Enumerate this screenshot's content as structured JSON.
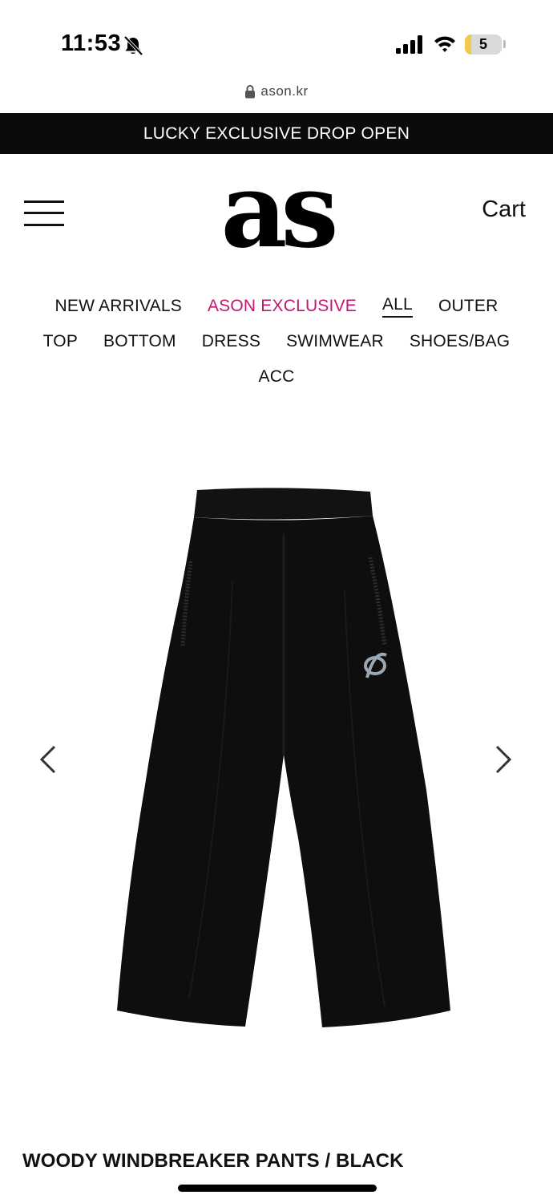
{
  "status_bar": {
    "time": "11:53",
    "battery_level": "5",
    "icons": [
      "bell-slash-icon",
      "signal-icon",
      "wifi-icon",
      "battery-icon"
    ]
  },
  "browser": {
    "url": "ason.kr"
  },
  "announcement": {
    "text": "LUCKY EXCLUSIVE DROP OPEN"
  },
  "header": {
    "logo_text": "as",
    "cart_label": "Cart"
  },
  "categories": {
    "row1": [
      "NEW ARRIVALS",
      "ASON EXCLUSIVE",
      "ALL",
      "OUTER"
    ],
    "row2": [
      "TOP",
      "BOTTOM",
      "DRESS",
      "SWIMWEAR",
      "SHOES/BAG"
    ],
    "row3": [
      "ACC"
    ],
    "active": "ALL",
    "accent_item": "ASON EXCLUSIVE",
    "accent_color": "#c3166f"
  },
  "product": {
    "title": "WOODY WINDBREAKER PANTS / BLACK",
    "image_subject": "black windbreaker pants"
  },
  "colors": {
    "announcement_bg": "#0b0b0b",
    "accent": "#c3166f",
    "text": "#111111"
  }
}
